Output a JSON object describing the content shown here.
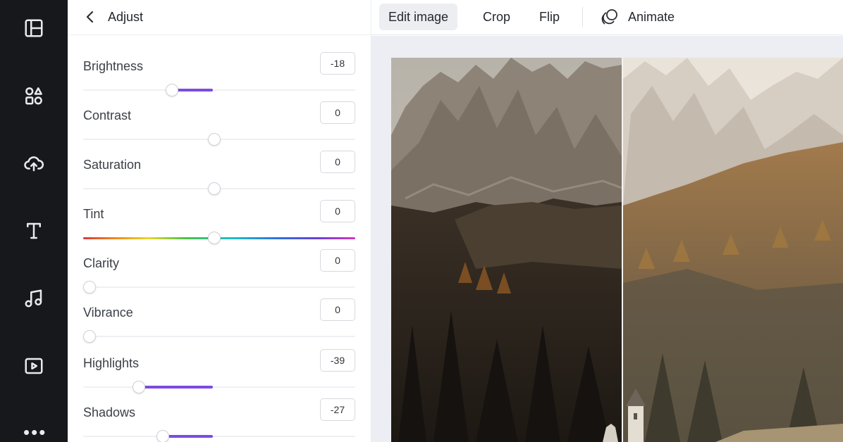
{
  "sidebar": {
    "icons": [
      "layout-icon",
      "elements-icon",
      "uploads-icon",
      "text-icon",
      "audio-icon",
      "video-icon"
    ],
    "more_label": "•••"
  },
  "adjust_panel": {
    "title": "Adjust",
    "items": [
      {
        "label": "Brightness",
        "value": "-18"
      },
      {
        "label": "Contrast",
        "value": "0"
      },
      {
        "label": "Saturation",
        "value": "0"
      },
      {
        "label": "Tint",
        "value": "0"
      },
      {
        "label": "Clarity",
        "value": "0"
      },
      {
        "label": "Vibrance",
        "value": "0"
      },
      {
        "label": "Highlights",
        "value": "-39"
      },
      {
        "label": "Shadows",
        "value": "-27"
      }
    ]
  },
  "toolbar": {
    "edit_image": "Edit image",
    "crop": "Crop",
    "flip": "Flip",
    "animate": "Animate"
  },
  "colors": {
    "accent": "#7d4be0",
    "rail": "#17181c",
    "canvas": "#eceef3"
  }
}
